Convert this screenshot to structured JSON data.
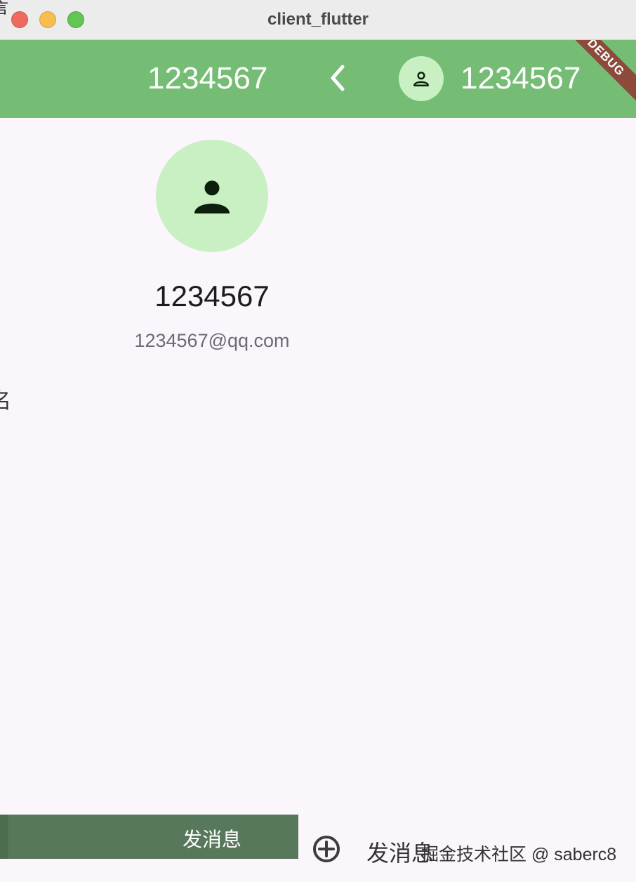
{
  "window": {
    "title": "client_flutter"
  },
  "appbar": {
    "title_left": "1234567",
    "title_right": "1234567",
    "color": "#75bd75",
    "icons": [
      "chevron-left-icon",
      "person-icon"
    ]
  },
  "debug_banner": {
    "label": "DEBUG"
  },
  "profile": {
    "name": "1234567",
    "email": "1234567@qq.com",
    "avatar_icon": "person-icon"
  },
  "fragments": {
    "left_top": "言",
    "left_mid": "名"
  },
  "bottom": {
    "send_button": "发消息",
    "send_label_2": "发消息",
    "add_icon": "add-circle-icon"
  },
  "watermark": "掘金技术社区 @ saberc8"
}
